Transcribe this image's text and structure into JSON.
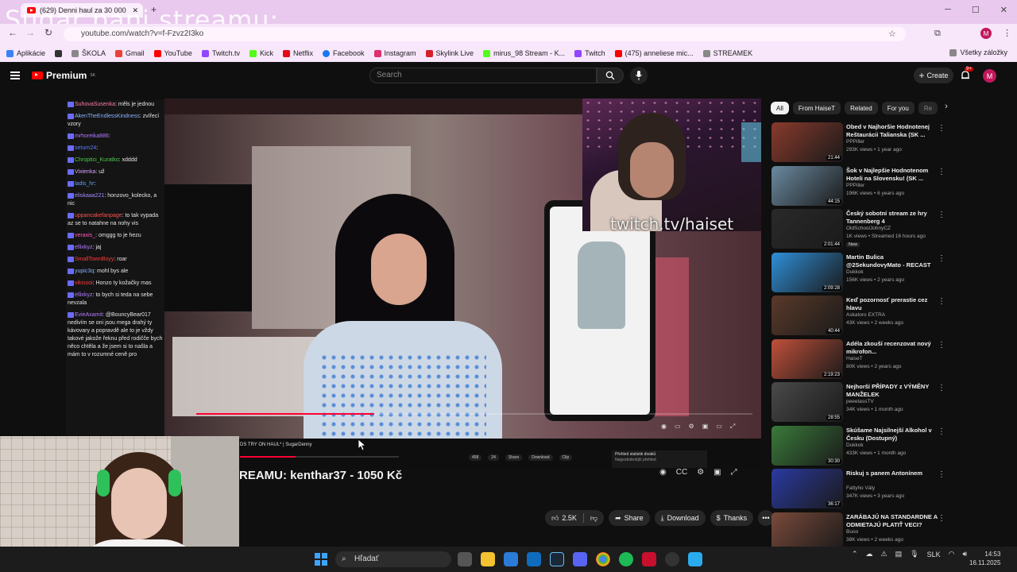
{
  "overlay_title": "Sugar pani streamu:",
  "browser": {
    "tab_title": "(629) Denni haul za 30 000",
    "url": "youtube.com/watch?v=f-Fzvz2I3ko",
    "bookmarks": [
      "Aplikácie",
      "ŠKOLA",
      "Gmail",
      "YouTube",
      "Twitch.tv",
      "Kick",
      "Netflix",
      "Facebook",
      "Instagram",
      "Skylink Live",
      "mirus_98 Stream - K...",
      "Twitch",
      "(475) anneliese mic...",
      "STREAMEK"
    ],
    "bookmarks_right": "Všetky záložky"
  },
  "youtube": {
    "logo": "Premium",
    "logo_sup": "SK",
    "search_placeholder": "Search",
    "create_label": "Create",
    "notif_count": "9+",
    "avatar_letter": "M"
  },
  "chat": [
    {
      "user": "SuhovaSusenka",
      "color": "#ff7aa8",
      "text": ": měls je jednou"
    },
    {
      "user": "AkenTheEndlessKindness",
      "color": "#8ab4ff",
      "text": ": zvířecí vzory"
    },
    {
      "user": "mrhoreika886",
      "color": "#b07cff",
      "text": ":"
    },
    {
      "user": "seturn24",
      "color": "#5b7cff",
      "text": ":"
    },
    {
      "user": "Chroptici_Kuratko",
      "color": "#4ec94e",
      "text": ": xdddd"
    },
    {
      "user": "Vixienka",
      "color": "#d7a5ff",
      "text": ": už"
    },
    {
      "user": "ladis_hr",
      "color": "#5ea0ff",
      "text": ":"
    },
    {
      "user": "eliskaaa221",
      "color": "#a58bff",
      "text": ": honzovo_kolecko, a nic"
    },
    {
      "user": "uppancakefanpage",
      "color": "#ff5050",
      "text": ": to tak vypada az se to natahne na nohy vis"
    },
    {
      "user": "veraxis_",
      "color": "#ff5cc1",
      "text": ": omggg to je hezu"
    },
    {
      "user": "ellixkyz",
      "color": "#b07cff",
      "text": ": jaj"
    },
    {
      "user": "SmallTownBoyy",
      "color": "#ff3b3b",
      "text": ": roar"
    },
    {
      "user": "yupic3q",
      "color": "#8ab4ff",
      "text": ": mohl bys ale"
    },
    {
      "user": "vikissoi",
      "color": "#ff3b3b",
      "text": ": Honzo ty kožačky mas"
    },
    {
      "user": "ellixkyz",
      "color": "#b07cff",
      "text": ": to bych si teda na sebe nevzala"
    },
    {
      "user": "EvieAxamit",
      "color": "#b07cff",
      "text": ": @BouncyBear017 nedivím se oni jsou mega drahý ty kávovary a popravdě ale to je vždy takové jakože řeknu před rodičče bych něco chtěla a že jsem si to našla a mám to v rozumné ceně pro"
    }
  ],
  "video": {
    "twitch_url": "twitch.tv/haiset",
    "strip_title": "DS TRY ON HAUL* | SugarDenny",
    "strip_actions": [
      "458",
      "24",
      "Share",
      "Download",
      "Clip"
    ],
    "popup_title": "Přehled statistik diváků",
    "popup_text": "Nejpodrobnější přehled",
    "progress": 0.32,
    "strip_progress": 0.35
  },
  "video_title": "REAMU: kenthar37 - 1050 Kč",
  "actions": {
    "likes": "2.5K",
    "share": "Share",
    "download": "Download",
    "thanks": "Thanks"
  },
  "chips": [
    "All",
    "From HaiseT",
    "Related",
    "For you",
    "Re"
  ],
  "recommendations": [
    {
      "title": "Obed v Najhoršie Hodnotenej Reštaurácii Talianska (SK ...",
      "channel": "PPPiller",
      "meta": "293K views • 1 year ago",
      "duration": "21:44",
      "thumb": "#8a3a2c"
    },
    {
      "title": "Šok v Najlepšie Hodnotenom Hoteli na Slovensku! (SK ...",
      "channel": "PPPiller",
      "meta": "196K views • 6 years ago",
      "duration": "44:15",
      "thumb": "#6b8aa0"
    },
    {
      "title": "Český sobotní stream ze hry Tannenberg 4",
      "channel": "OldSchoolJohnyCZ",
      "meta": "1K views • Streamed 16 hours ago",
      "duration": "2:01:44",
      "thumb": "#2a2a2a",
      "badge": "New"
    },
    {
      "title": "Martin Bulica @2SekundovyMato - RECAST",
      "channel": "Dukkok",
      "meta": "156K views • 2 years ago",
      "duration": "2:09:28",
      "thumb": "#2f8fd8"
    },
    {
      "title": "Keď pozornosť prerastie cez hlavu",
      "channel": "Askatoro EXTRA",
      "meta": "43K views • 2 weeks ago",
      "duration": "40:44",
      "thumb": "#5a3a2a"
    },
    {
      "title": "Adéla zkouší recenzovat nový mikrofon...",
      "channel": "HaiseT",
      "meta": "80K views • 2 years ago",
      "duration": "2:19:23",
      "thumb": "#c0503a"
    },
    {
      "title": "Nejhorší PŘÍPADY z VÝMĚNY MANŽELEK",
      "channel": "peeetassTV",
      "meta": "34K views • 1 month ago",
      "duration": "28:55",
      "thumb": "#4a4a4a"
    },
    {
      "title": "Skúšame Najsilnejší Alkohol v Česku (Dostupný)",
      "channel": "Dukkok",
      "meta": "433K views • 1 month ago",
      "duration": "30:30",
      "thumb": "#3a7a3a"
    },
    {
      "title": "Riskuj s panem Antonínem",
      "channel": "Fattyho Vály",
      "meta": "347K views • 3 years ago",
      "duration": "36:17",
      "thumb": "#2a3aa0"
    },
    {
      "title": "ZARÁBAJÚ NA STANDARDNE A ODMIETAJÚ PLATIŤ VECI?",
      "channel": "Buoo",
      "meta": "38K views • 2 weeks ago",
      "duration": "",
      "thumb": "#7a4a3a"
    }
  ],
  "taskbar": {
    "search": "Hľadať",
    "lang": "SLK",
    "time": "14:53",
    "date": "16.11.2025"
  }
}
